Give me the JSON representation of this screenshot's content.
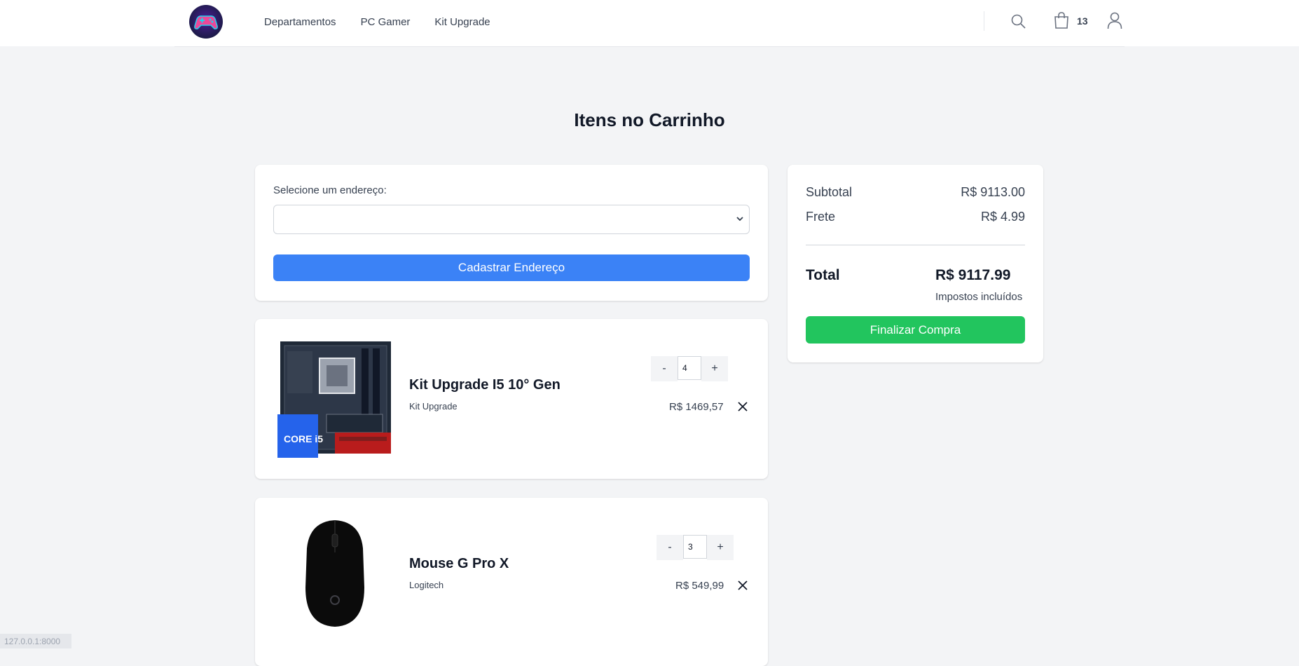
{
  "header": {
    "nav": [
      "Departamentos",
      "PC Gamer",
      "Kit Upgrade"
    ],
    "cart_count": "13"
  },
  "page_title": "Itens no Carrinho",
  "address": {
    "label": "Selecione um endereço:",
    "selected": "",
    "register_button": "Cadastrar Endereço"
  },
  "summary": {
    "subtotal_label": "Subtotal",
    "subtotal_value": "R$ 9113.00",
    "shipping_label": "Frete",
    "shipping_value": "R$ 4.99",
    "total_label": "Total",
    "total_value": "R$ 9117.99",
    "tax_note": "Impostos incluídos",
    "checkout_button": "Finalizar Compra"
  },
  "items": [
    {
      "name": "Kit Upgrade I5 10° Gen",
      "brand": "Kit Upgrade",
      "quantity": "4",
      "price": "R$ 1469,57",
      "minus": "-",
      "plus": "+"
    },
    {
      "name": "Mouse G Pro X",
      "brand": "Logitech",
      "quantity": "3",
      "price": "R$ 549,99",
      "minus": "-",
      "plus": "+"
    }
  ],
  "status_bar": "127.0.0.1:8000",
  "colors": {
    "primary_blue": "#3b82f6",
    "success_green": "#22c55e",
    "background": "#f3f4f6"
  },
  "icons": [
    "gamepad-logo",
    "search-icon",
    "shopping-bag-icon",
    "user-icon",
    "chevron-down-icon",
    "close-icon"
  ]
}
